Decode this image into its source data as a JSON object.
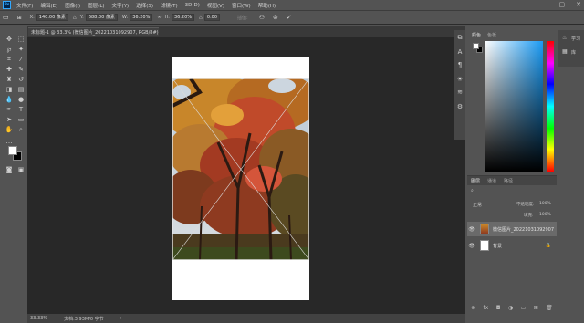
{
  "app": {
    "logo": "Ps"
  },
  "menu": [
    "文件(F)",
    "编辑(E)",
    "图像(I)",
    "图层(L)",
    "文字(Y)",
    "选择(S)",
    "滤镜(T)",
    "3D(D)",
    "视图(V)",
    "窗口(W)",
    "帮助(H)"
  ],
  "window_controls": {
    "minimize": "—",
    "maximize": "▢",
    "close": "✕"
  },
  "options": {
    "x_label": "X:",
    "x_value": "140.00 像素",
    "y_label": "Y:",
    "y_value": "688.00 像素",
    "w_label": "W:",
    "w_value": "36.20%",
    "h_label": "H:",
    "h_value": "36.20%",
    "angle_label": "△",
    "angle_value": "0.00",
    "interp_label": "插值:",
    "cancel_icon": "cancel-icon",
    "commit_icon": "check-icon"
  },
  "document": {
    "tab_title": "未标题-1 @ 33.3% (微信图片_20221031092907, RGB/8#)",
    "close": "×"
  },
  "status": {
    "zoom": "33.33%",
    "doc_size": "文档:3.93M/0 字节"
  },
  "panels": {
    "color": {
      "tab1": "颜色",
      "tab2": "色板"
    },
    "layers": {
      "tabs": [
        "图层",
        "通道",
        "路径"
      ],
      "blend_mode": "正常",
      "opacity_label": "不透明度:",
      "opacity_value": "100%",
      "fill_label": "填充:",
      "fill_value": "100%",
      "items": [
        {
          "name": "微信图片_20221031092907"
        },
        {
          "name": "背景"
        }
      ]
    },
    "right": {
      "tab1": "学习",
      "tab2": "库"
    }
  },
  "colors": {
    "foreground": "#ffffff",
    "background": "#000000",
    "accent": "#31a8ff"
  }
}
